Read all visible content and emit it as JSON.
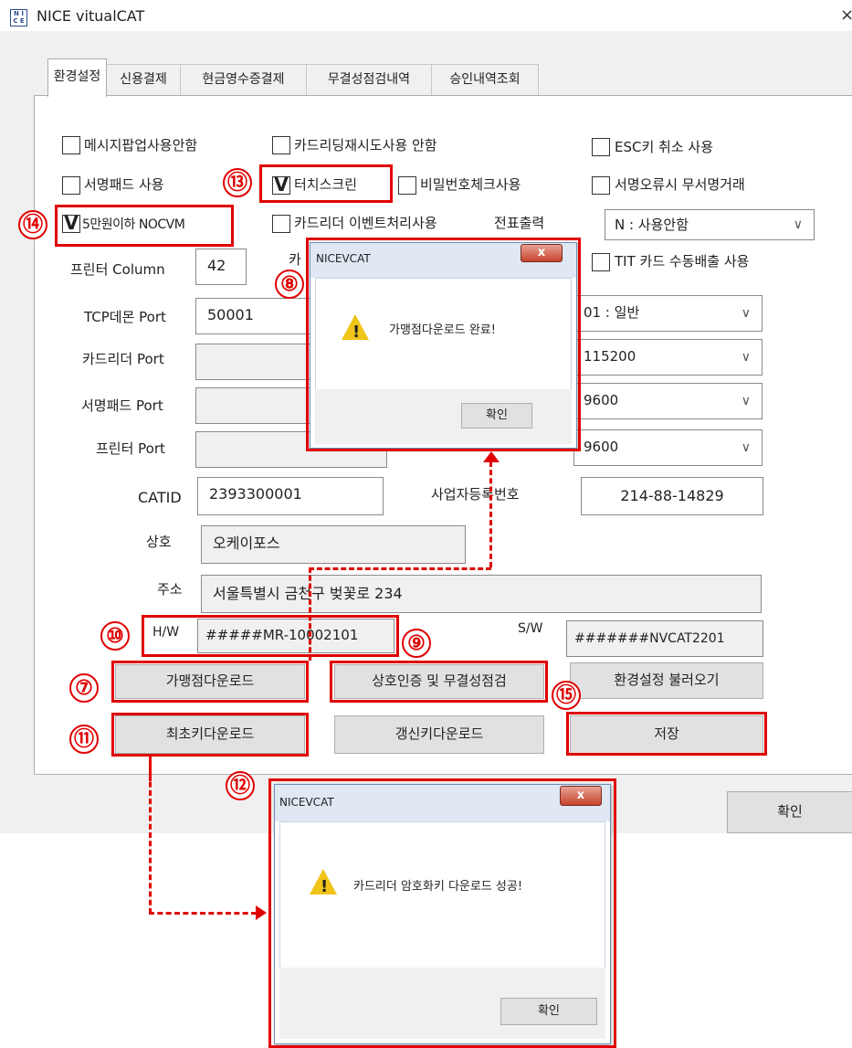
{
  "window": {
    "title": "NICE vitualCAT",
    "icon_text": "N I\nC E",
    "close": "×"
  },
  "tabs": [
    "환경설정",
    "신용결제",
    "현금영수증결제",
    "무결성점검내역",
    "승인내역조회"
  ],
  "checkboxes": {
    "popup_off": {
      "label": "메시지팝업사용안함",
      "checked": false
    },
    "card_retry_off": {
      "label": "카드리딩재시도사용 안함",
      "checked": false
    },
    "esc_cancel": {
      "label": "ESC키 취소 사용",
      "checked": false
    },
    "sign_pad": {
      "label": "서명패드 사용",
      "checked": false
    },
    "touchscreen": {
      "label": "터치스크린",
      "checked": true
    },
    "pw_check": {
      "label": "비밀번호체크사용",
      "checked": false
    },
    "sign_error_nosign": {
      "label": "서명오류시 무서명거래",
      "checked": false
    },
    "nocvm": {
      "label": "5만원이하 NOCVM",
      "checked": true
    },
    "cardreader_event": {
      "label": "카드리더 이벤트처리사용",
      "checked": false
    },
    "tit_manual": {
      "label": "TIT 카드 수동배출 사용",
      "checked": false
    }
  },
  "checkmark": "V",
  "receipt": {
    "label": "전표출력",
    "value": "N : 사용안함"
  },
  "printer_column": {
    "label": "프린터 Column",
    "value": "42"
  },
  "hidden_label_fragment": "카",
  "ports": {
    "tcp": {
      "label": "TCP데몬 Port",
      "value": "50001",
      "option": "01 : 일반"
    },
    "cardreader": {
      "label": "카드리더 Port",
      "value": "",
      "option": "115200"
    },
    "signpad": {
      "label": "서명패드 Port",
      "value": "",
      "option": "9600"
    },
    "printer": {
      "label": "프린터 Port",
      "value": "",
      "option": "9600"
    }
  },
  "catid": {
    "label": "CATID",
    "value": "2393300001"
  },
  "bizno": {
    "label": "사업자등록번호",
    "value": "214-88-14829"
  },
  "shop": {
    "label": "상호",
    "value": "오케이포스"
  },
  "address": {
    "label": "주소",
    "value": "서울특별시 금천구 벚꽃로 234"
  },
  "hw": {
    "label": "H/W",
    "value": "#####MR-10002101"
  },
  "sw": {
    "label": "S/W",
    "value": "#######NVCAT2201"
  },
  "buttons": {
    "merchant_download": "가맹점다운로드",
    "mutual_auth": "상호인증 및 무결성점검",
    "load_settings": "환경설정 불러오기",
    "initial_key": "최초키다운로드",
    "renew_key": "갱신키다운로드",
    "save": "저장",
    "ok": "확인"
  },
  "dialog_merchant": {
    "title": "NICEVCAT",
    "message": "가맹점다운로드 완료!",
    "ok": "확인",
    "close": "x"
  },
  "dialog_key": {
    "title": "NICEVCAT",
    "message": "카드리더 암호화키 다운로드 성공!",
    "ok": "확인",
    "close": "x"
  },
  "warning_mark": "!",
  "markers": {
    "m7": "⑦",
    "m8": "⑧",
    "m9": "⑨",
    "m10": "⑩",
    "m11": "⑪",
    "m12": "⑫",
    "m13": "⑬",
    "m14": "⑭",
    "m15": "⑮"
  },
  "colors": {
    "highlight": "#e00000",
    "window_bg": "#f0f0f0",
    "button_bg": "#e1e1e1",
    "warning": "#f0c419"
  }
}
